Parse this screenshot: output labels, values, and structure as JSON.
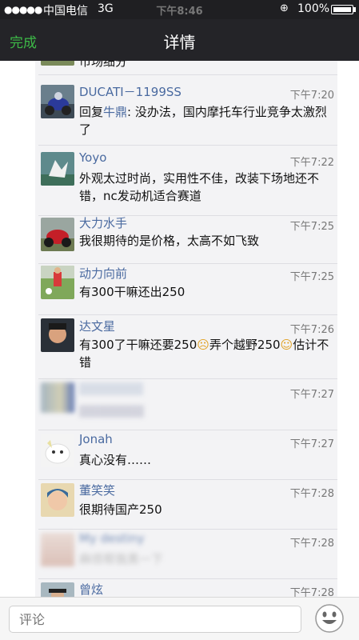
{
  "status": {
    "signal": "●●●●●",
    "carrier": "中国电信",
    "network": "3G",
    "time": "下午8:46",
    "battery": "100%"
  },
  "nav": {
    "done": "完成",
    "title": "详情"
  },
  "partial_top": "市场细分",
  "comments": [
    {
      "name": "DUCATI－1199SS",
      "time": "下午7:20",
      "reply_prefix": "回复",
      "mention": "牛鼎",
      "text": ": 没办法，国内摩托车行业竞争太激烈了"
    },
    {
      "name": "Yoyo",
      "time": "下午7:22",
      "text": "外观太过时尚，实用性不佳，改装下场地还不错，nc发动机适合赛道"
    },
    {
      "name": "大力水手",
      "time": "下午7:25",
      "text": "我很期待的是价格，太高不如飞致"
    },
    {
      "name": "动力向前",
      "time": "下午7:25",
      "text": "有300干嘛还出250"
    },
    {
      "name": "达文星",
      "time": "下午7:26",
      "text_a": "有300了干嘛还要250",
      "text_b": "弄个越野250",
      "text_c": "估计不错"
    },
    {
      "name": "",
      "time": "下午7:27",
      "text": "▇▇▇▇▇▇▇"
    },
    {
      "name": "Jonah",
      "time": "下午7:27",
      "text": "真心没有……"
    },
    {
      "name": "董笑笑",
      "time": "下午7:28",
      "text": "很期待国产250"
    },
    {
      "name": "My destiny",
      "time": "下午7:28",
      "text": "麻烦帮我黑一下"
    },
    {
      "name": "曾炫",
      "time": "下午7:28",
      "text": ""
    }
  ],
  "bottom": {
    "placeholder": "评论"
  },
  "icons": {
    "emoji": "smiley-face-icon"
  },
  "colors": {
    "accent_green": "#3dba47",
    "name_blue": "#4a6aa0",
    "nav_bg": "#242428"
  }
}
